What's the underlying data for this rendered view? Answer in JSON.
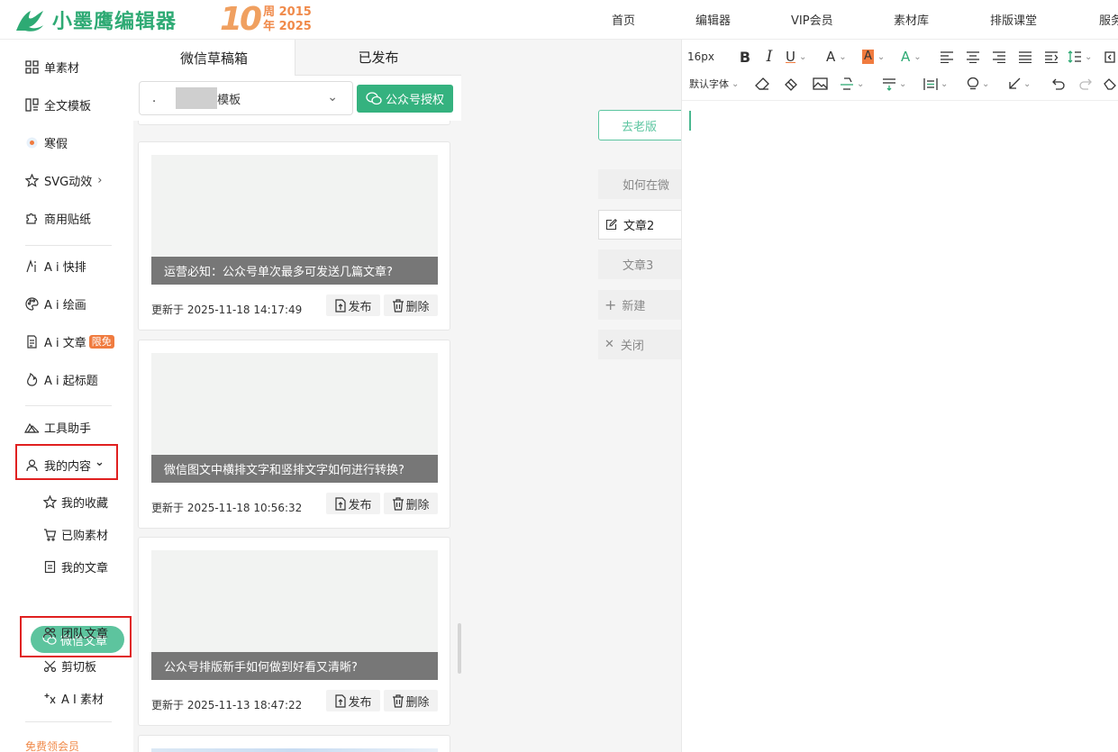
{
  "header": {
    "logo_text": "小墨鹰编辑器",
    "anniv_number": "10",
    "anniv_top": "周 2015",
    "anniv_bottom": "年 2025",
    "nav": [
      "首页",
      "编辑器",
      "VIP会员",
      "素材库",
      "排版课堂",
      "服务"
    ]
  },
  "sidebar": {
    "items": [
      {
        "label": "单素材",
        "icon": "grid-icon"
      },
      {
        "label": "全文模板",
        "icon": "layout-icon"
      },
      {
        "label": "寒假",
        "icon": "holiday-icon"
      },
      {
        "label": "SVG动效",
        "icon": "star-icon",
        "suffix": "›"
      },
      {
        "label": "商用贴纸",
        "icon": "puzzle-icon"
      },
      {
        "label": "A i 快排",
        "icon": "ai-sparkle-icon"
      },
      {
        "label": "A i 绘画",
        "icon": "palette-icon"
      },
      {
        "label": "A i 文章",
        "icon": "doc-icon",
        "badge": "限免"
      },
      {
        "label": "A i 起标题",
        "icon": "fire-icon"
      },
      {
        "label": "工具助手",
        "icon": "tool-icon"
      },
      {
        "label": "我的内容",
        "icon": "user-icon",
        "suffix": "⌄"
      }
    ],
    "sub_items": [
      {
        "label": "我的收藏",
        "icon": "star-outline-icon"
      },
      {
        "label": "已购素材",
        "icon": "cart-icon"
      },
      {
        "label": "我的文章",
        "icon": "article-icon"
      },
      {
        "label": "微信文章",
        "icon": "wechat-icon"
      },
      {
        "label": "团队文章",
        "icon": "team-icon"
      },
      {
        "label": "剪切板",
        "icon": "scissors-icon"
      },
      {
        "label": "A I 素材",
        "icon": "ai-material-icon"
      }
    ],
    "promo": "免费领会员"
  },
  "middle": {
    "tabs": [
      "微信草稿箱",
      "已发布"
    ],
    "select_text": "模板",
    "auth_button": "公众号授权",
    "cards": [
      {
        "title": "运营必知：公众号单次最多可发送几篇文章?",
        "time": "更新于 2025-11-18 14:17:49"
      },
      {
        "title": "微信图文中横排文字和竖排文字如何进行转换?",
        "time": "更新于 2025-11-18 10:56:32"
      },
      {
        "title": "公众号排版新手如何做到好看又清晰?",
        "time": "更新于 2025-11-13 18:47:22"
      }
    ],
    "publish_label": "发布",
    "delete_label": "删除"
  },
  "gutter": {
    "old_version": "去老版",
    "doc_tabs": [
      "如何在微",
      "文章2",
      "文章3",
      "新建",
      "关闭"
    ]
  },
  "editor": {
    "font_size": "16px",
    "default_font": "默认字体",
    "accent_color": "#35b27f",
    "highlight_color": "#f07b3f"
  }
}
